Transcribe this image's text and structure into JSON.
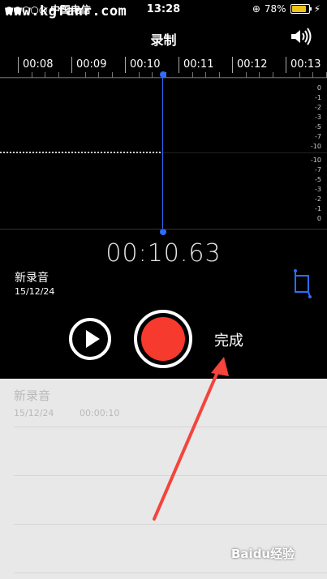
{
  "status_bar": {
    "carrier": "中国电信",
    "time": "13:28",
    "battery": "78%"
  },
  "watermark": "www.kgfanr.com",
  "header": {
    "title": "录制"
  },
  "timeline": [
    "00:08",
    "00:09",
    "00:10",
    "00:11",
    "00:12",
    "00:13"
  ],
  "db_labels_top": [
    "0",
    "-1",
    "-2",
    "-3",
    "-5",
    "-7",
    "-10"
  ],
  "db_labels_bottom": [
    "-10",
    "-7",
    "-5",
    "-3",
    "-2",
    "-1",
    "0"
  ],
  "timer": "00:10.63",
  "recording": {
    "name": "新录音",
    "date": "15/12/24"
  },
  "controls": {
    "done_label": "完成"
  },
  "list": [
    {
      "name": "新录音",
      "date": "15/12/24",
      "duration": "00:00:10"
    }
  ],
  "colors": {
    "record": "#f63a2d",
    "cursor": "#2f6cff",
    "arrow": "#f4443c",
    "battery": "#f2c21a"
  },
  "icons": [
    "speaker-icon",
    "trim-icon",
    "play-icon",
    "record-icon",
    "battery-icon",
    "orientation-lock-icon",
    "charging-icon"
  ],
  "baidu_watermark": "Baidu经验"
}
